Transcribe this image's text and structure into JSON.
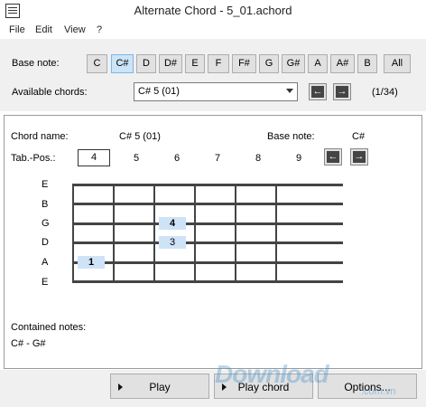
{
  "window": {
    "title": "Alternate Chord - 5_01.achord"
  },
  "menu": {
    "items": [
      "File",
      "Edit",
      "View",
      "?"
    ]
  },
  "base_note": {
    "label": "Base note:",
    "notes": [
      "C",
      "C#",
      "D",
      "D#",
      "E",
      "F",
      "F#",
      "G",
      "G#",
      "A",
      "A#",
      "B",
      "All"
    ],
    "selected": "C#"
  },
  "available_chords": {
    "label": "Available chords:",
    "value": "C# 5 (01)",
    "counter": "(1/34)"
  },
  "chord_panel": {
    "chord_name_label": "Chord name:",
    "chord_name_value": "C# 5 (01)",
    "base_note_label": "Base note:",
    "base_note_value": "C#",
    "tab_pos_label": "Tab.-Pos.:",
    "tab_positions": [
      "4",
      "5",
      "6",
      "7",
      "8",
      "9"
    ],
    "strings": [
      "E",
      "B",
      "G",
      "D",
      "A",
      "E"
    ],
    "fingers": [
      {
        "string": "G",
        "fret": 3,
        "label": "4",
        "bold": true
      },
      {
        "string": "D",
        "fret": 3,
        "label": "3",
        "bold": false
      },
      {
        "string": "A",
        "fret": 1,
        "label": "1",
        "bold": true
      }
    ],
    "contained_notes_label": "Contained notes:",
    "contained_notes_value": "C# - G#"
  },
  "buttons": {
    "play": "Play",
    "play_chord": "Play chord",
    "options": "Options..."
  },
  "watermark": {
    "text": "Download",
    "suffix": ".com.vn"
  }
}
